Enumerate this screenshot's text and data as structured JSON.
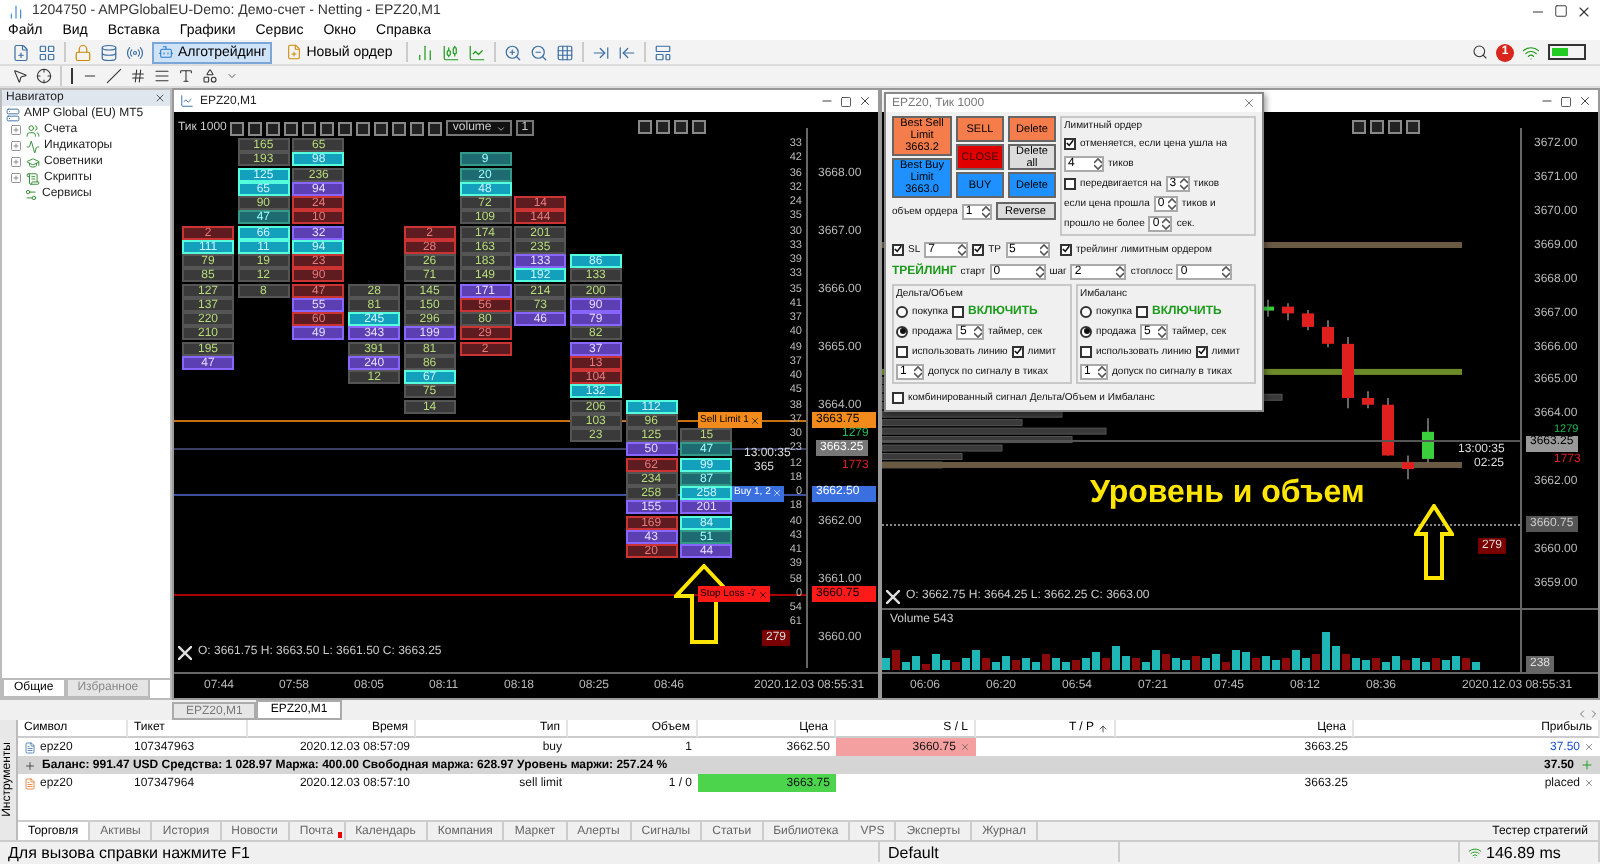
{
  "window": {
    "title": "1204750 - AMPGlobalEU-Demo: Демо-счет - Netting - EPZ20,M1",
    "notifications": "1"
  },
  "menu": [
    "Файл",
    "Вид",
    "Вставка",
    "Графики",
    "Сервис",
    "Окно",
    "Справка"
  ],
  "toolbar": {
    "algo": {
      "label": "Алготрейдинг",
      "on": true
    },
    "new_order": {
      "label": "Новый ордер"
    }
  },
  "navigator": {
    "title": "Навигатор",
    "root": "AMP Global (EU) MT5",
    "items": [
      {
        "label": "Счета",
        "kind": "accounts",
        "expandable": true
      },
      {
        "label": "Индикаторы",
        "kind": "indicators",
        "expandable": true
      },
      {
        "label": "Советники",
        "kind": "experts",
        "expandable": true
      },
      {
        "label": "Скрипты",
        "kind": "scripts",
        "expandable": true
      },
      {
        "label": "Сервисы",
        "kind": "services",
        "expandable": false
      }
    ],
    "tabs": [
      {
        "label": "Общие",
        "selected": true
      },
      {
        "label": "Избранное",
        "selected": false
      }
    ]
  },
  "chart1": {
    "title": "EPZ20,M1",
    "timeframe": "Тик  1000",
    "indicator": "volume",
    "multiplier": "1",
    "columns": [
      [
        {
          "v": "2",
          "kind": "red"
        },
        {
          "v": "111",
          "kind": "cyan"
        },
        {
          "v": "79",
          "kind": "plain"
        },
        {
          "v": "85",
          "kind": "plain"
        },
        {
          "v": "127",
          "kind": "plain"
        },
        {
          "v": "137",
          "kind": "plain"
        },
        {
          "v": "220",
          "kind": "plain"
        },
        {
          "v": "210",
          "kind": "plain"
        },
        {
          "v": "195",
          "kind": "plain"
        },
        {
          "v": "47",
          "kind": "purple"
        }
      ],
      [
        {
          "v": "165",
          "kind": "plain"
        },
        {
          "v": "193",
          "kind": "plain"
        },
        {
          "v": "125",
          "kind": "cyan"
        },
        {
          "v": "65",
          "kind": "cyan"
        },
        {
          "v": "90",
          "kind": "plain"
        },
        {
          "v": "47",
          "kind": "teal"
        },
        {
          "v": "66",
          "kind": "cyan"
        },
        {
          "v": "11",
          "kind": "cyan"
        },
        {
          "v": "19",
          "kind": "plain"
        },
        {
          "v": "12",
          "kind": "plain"
        },
        {
          "v": "8",
          "kind": "plain"
        }
      ],
      [
        {
          "v": "65",
          "kind": "plain"
        },
        {
          "v": "98",
          "kind": "cyan"
        },
        {
          "v": "236",
          "kind": "plain"
        },
        {
          "v": "94",
          "kind": "purple"
        },
        {
          "v": "24",
          "kind": "red"
        },
        {
          "v": "10",
          "kind": "red"
        },
        {
          "v": "32",
          "kind": "purple"
        },
        {
          "v": "94",
          "kind": "cyan"
        },
        {
          "v": "23",
          "kind": "red"
        },
        {
          "v": "90",
          "kind": "red"
        },
        {
          "v": "47",
          "kind": "red"
        },
        {
          "v": "55",
          "kind": "purple"
        },
        {
          "v": "60",
          "kind": "red"
        },
        {
          "v": "49",
          "kind": "purple"
        }
      ],
      [
        {
          "v": "28",
          "kind": "plain"
        },
        {
          "v": "81",
          "kind": "plain"
        },
        {
          "v": "245",
          "kind": "cyan"
        },
        {
          "v": "343",
          "kind": "purple"
        },
        {
          "v": "391",
          "kind": "plain"
        },
        {
          "v": "240",
          "kind": "purple"
        },
        {
          "v": "12",
          "kind": "plain"
        }
      ],
      [
        {
          "v": "2",
          "kind": "red"
        },
        {
          "v": "28",
          "kind": "red"
        },
        {
          "v": "26",
          "kind": "plain"
        },
        {
          "v": "71",
          "kind": "plain"
        },
        {
          "v": "145",
          "kind": "plain"
        },
        {
          "v": "150",
          "kind": "plain"
        },
        {
          "v": "296",
          "kind": "plain"
        },
        {
          "v": "199",
          "kind": "purple"
        },
        {
          "v": "81",
          "kind": "plain"
        },
        {
          "v": "86",
          "kind": "plain"
        },
        {
          "v": "67",
          "kind": "cyan"
        },
        {
          "v": "75",
          "kind": "plain"
        },
        {
          "v": "14",
          "kind": "plain"
        }
      ],
      [
        {
          "v": "9",
          "kind": "teal"
        },
        {
          "v": "20",
          "kind": "teal"
        },
        {
          "v": "48",
          "kind": "cyan"
        },
        {
          "v": "72",
          "kind": "plain"
        },
        {
          "v": "109",
          "kind": "plain"
        },
        {
          "v": "174",
          "kind": "plain"
        },
        {
          "v": "163",
          "kind": "plain"
        },
        {
          "v": "183",
          "kind": "plain"
        },
        {
          "v": "149",
          "kind": "plain"
        },
        {
          "v": "171",
          "kind": "purple"
        },
        {
          "v": "56",
          "kind": "red"
        },
        {
          "v": "80",
          "kind": "plain"
        },
        {
          "v": "29",
          "kind": "red"
        },
        {
          "v": "2",
          "kind": "red"
        }
      ],
      [
        {
          "v": "14",
          "kind": "red"
        },
        {
          "v": "144",
          "kind": "red"
        },
        {
          "v": "201",
          "kind": "plain"
        },
        {
          "v": "235",
          "kind": "plain"
        },
        {
          "v": "133",
          "kind": "purple"
        },
        {
          "v": "192",
          "kind": "cyan"
        },
        {
          "v": "214",
          "kind": "plain"
        },
        {
          "v": "73",
          "kind": "plain"
        },
        {
          "v": "46",
          "kind": "purple"
        }
      ],
      [
        {
          "v": "86",
          "kind": "cyan"
        },
        {
          "v": "133",
          "kind": "plain"
        },
        {
          "v": "200",
          "kind": "plain"
        },
        {
          "v": "90",
          "kind": "purple"
        },
        {
          "v": "79",
          "kind": "purple"
        },
        {
          "v": "82",
          "kind": "plain"
        },
        {
          "v": "37",
          "kind": "purple"
        },
        {
          "v": "13",
          "kind": "red"
        },
        {
          "v": "104",
          "kind": "red"
        },
        {
          "v": "132",
          "kind": "cyan"
        },
        {
          "v": "206",
          "kind": "plain"
        },
        {
          "v": "103",
          "kind": "plain"
        },
        {
          "v": "23",
          "kind": "plain"
        }
      ],
      [
        {
          "v": "112",
          "kind": "cyan"
        },
        {
          "v": "96",
          "kind": "plain"
        },
        {
          "v": "125",
          "kind": "plain"
        },
        {
          "v": "50",
          "kind": "purple"
        },
        {
          "v": "62",
          "kind": "red"
        },
        {
          "v": "234",
          "kind": "plain"
        },
        {
          "v": "258",
          "kind": "plain"
        },
        {
          "v": "155",
          "kind": "purple"
        },
        {
          "v": "169",
          "kind": "red"
        },
        {
          "v": "43",
          "kind": "purple"
        },
        {
          "v": "20",
          "kind": "red"
        }
      ],
      [
        {
          "v": "15",
          "kind": "plain"
        },
        {
          "v": "47",
          "kind": "teal"
        },
        {
          "v": "99",
          "kind": "cyan"
        },
        {
          "v": "87",
          "kind": "teal"
        },
        {
          "v": "258",
          "kind": "cyan"
        },
        {
          "v": "201",
          "kind": "purple"
        },
        {
          "v": "84",
          "kind": "cyan"
        },
        {
          "v": "51",
          "kind": "teal"
        },
        {
          "v": "44",
          "kind": "purple"
        }
      ]
    ],
    "depth": [
      "33",
      "42",
      "36",
      "32",
      "24",
      "35",
      "30",
      "33",
      "39",
      "33",
      "35",
      "41",
      "37",
      "40",
      "49",
      "37",
      "40",
      "45",
      "38",
      "37",
      "30",
      "23",
      "12",
      "18",
      "0",
      "18",
      "40",
      "43",
      "41",
      "39",
      "58",
      "0",
      "54",
      "61"
    ],
    "profile_max": "279",
    "prices": [
      "3668.00",
      "3667.00",
      "3666.00",
      "3665.00",
      "3664.00",
      "3662.00",
      "3661.00",
      "3660.00"
    ],
    "orders": [
      {
        "kind": "sell_limit",
        "label": "Sell Limit  1",
        "price": "3663.75"
      },
      {
        "kind": "buy",
        "label": "Buy  1,  2",
        "price": "3662.50"
      },
      {
        "kind": "stop_loss",
        "label": "Stop Loss  -7",
        "price": "3660.75"
      }
    ],
    "bid_volume": "1279",
    "last_price": "3663.25",
    "ask_volume": "1773",
    "timer": "13:00:35",
    "timer_sub": "365",
    "ohlc": "O: 3661.75   H: 3663.50   L: 3661.50   C: 3663.25",
    "times": [
      "07:44",
      "07:58",
      "08:05",
      "08:11",
      "08:18",
      "08:25",
      "08:46"
    ],
    "date": "2020.12.03 08:55:31"
  },
  "chart2": {
    "prices": [
      "3672.00",
      "3671.00",
      "3670.00",
      "3669.00",
      "3668.00",
      "3667.00",
      "3666.00",
      "3665.00",
      "3664.00",
      "3662.00",
      "3660.00",
      "3659.00"
    ],
    "bid_volume": "1279",
    "last_price": "3663.25",
    "ask_volume": "1773",
    "cursor_price": "3660.75",
    "profile_max": "279",
    "timer": "13:00:35",
    "timer_sub": "02:25",
    "caption": "Уровень и объем",
    "ohlc": "O: 3662.75   H: 3664.25   L: 3662.25   C: 3663.00",
    "volume_label": "Volume 543",
    "volume_axis": "238",
    "times": [
      "06:06",
      "06:20",
      "06:54",
      "07:21",
      "07:45",
      "08:12",
      "08:36"
    ],
    "date": "2020.12.03 08:55:31"
  },
  "panel": {
    "title": "EPZ20,  Тик  1000",
    "best": [
      {
        "label": "Best Sell Limit 3663.2",
        "kind": "sell"
      },
      {
        "label": "Best Buy Limit 3663.0",
        "kind": "buy"
      }
    ],
    "buttons": [
      {
        "label": "SELL",
        "kind": "sell"
      },
      {
        "label": "Delete",
        "kind": "sell"
      },
      {
        "label": "CLOSE",
        "kind": "close"
      },
      {
        "label": "Delete all",
        "kind": "neutral"
      },
      {
        "label": "BUY",
        "kind": "buy"
      },
      {
        "label": "Delete",
        "kind": "buy"
      }
    ],
    "volume": {
      "label": "объем ордера",
      "value": "1"
    },
    "reverse": "Reverse",
    "sl": {
      "label": "SL",
      "checked": true,
      "value": "7"
    },
    "tp": {
      "label": "TP",
      "checked": true,
      "value": "5"
    },
    "trailing": {
      "title": "ТРЕЙЛИНГ",
      "fields": [
        {
          "label": "старт",
          "value": "0"
        },
        {
          "label": "шаг",
          "value": "2"
        },
        {
          "label": "стоплосс",
          "value": "0"
        }
      ]
    },
    "limit_order": {
      "title": "Лимитный ордер",
      "cancel": {
        "label": "отменяется, если цена ушла на",
        "checked": true,
        "value": "4",
        "unit": "тиков"
      },
      "move": {
        "label": "передвигается на",
        "checked": false,
        "value": "3",
        "unit": "тиков"
      },
      "if_price": {
        "label": "если цена прошла",
        "value": "0",
        "unit": "тиков и"
      },
      "if_time": {
        "label": "прошло не более",
        "value": "0",
        "unit": "сек."
      },
      "trailing": {
        "label": "трейлинг лимитным ордером",
        "checked": true
      }
    },
    "groups": [
      {
        "title": "Дельта/Объем",
        "modes": [
          {
            "label": "покупка",
            "selected": false
          },
          {
            "label": "продажа",
            "selected": true
          }
        ],
        "enable": {
          "label": "ВКЛЮЧИТЬ",
          "checked": false
        },
        "timer": {
          "value": "5",
          "label": "таймер, сек"
        },
        "use_line": {
          "label": "использовать линию",
          "checked": false
        },
        "limit": {
          "label": "лимит",
          "checked": true
        },
        "tolerance": {
          "value": "1",
          "label": "допуск по сигналу в тиках"
        }
      },
      {
        "title": "Имбаланс",
        "modes": [
          {
            "label": "покупка",
            "selected": false
          },
          {
            "label": "продажа",
            "selected": true
          }
        ],
        "enable": {
          "label": "ВКЛЮЧИТЬ",
          "checked": false
        },
        "timer": {
          "value": "5",
          "label": "таймер, сек"
        },
        "use_line": {
          "label": "использовать линию",
          "checked": false
        },
        "limit": {
          "label": "лимит",
          "checked": true
        },
        "tolerance": {
          "value": "1",
          "label": "допуск по сигналу в тиках"
        }
      }
    ],
    "combined": {
      "label": "комбинированный сигнал Дельта/Объем и Имбаланс",
      "checked": false
    }
  },
  "chart_tabs": [
    {
      "label": "EPZ20,M1",
      "selected": false
    },
    {
      "label": "EPZ20,M1",
      "selected": true
    }
  ],
  "trade": {
    "side_label": "Инструменты",
    "columns": [
      "Символ",
      "Тикет",
      "Время",
      "Тип",
      "Объем",
      "Цена",
      "S / L",
      "T / P",
      "Цена",
      "Прибыль"
    ],
    "rows": [
      {
        "kind": "position",
        "symbol": "epz20",
        "ticket": "107347963",
        "time": "2020.12.03 08:57:09",
        "type": "buy",
        "volume": "1",
        "price": "3662.50",
        "sl": "3660.75",
        "current": "3663.25",
        "profit": "37.50"
      },
      {
        "kind": "balance",
        "text": "Баланс: 991.47 USD   Средства: 1 028.97   Маржа: 400.00   Свободная маржа: 628.97   Уровень маржи: 257.24 %",
        "profit": "37.50"
      },
      {
        "kind": "order",
        "symbol": "epz20",
        "ticket": "107347964",
        "time": "2020.12.03 08:57:10",
        "type": "sell limit",
        "volume": "1 / 0",
        "price": "3663.75",
        "current": "3663.25",
        "profit": "placed"
      }
    ],
    "tabs": [
      {
        "label": "Торговля",
        "selected": true,
        "new": false
      },
      {
        "label": "Активы",
        "selected": false,
        "new": false
      },
      {
        "label": "История",
        "selected": false,
        "new": false
      },
      {
        "label": "Новости",
        "selected": false,
        "new": false
      },
      {
        "label": "Почта",
        "selected": false,
        "new": true
      },
      {
        "label": "Календарь",
        "selected": false,
        "new": false
      },
      {
        "label": "Компания",
        "selected": false,
        "new": false
      },
      {
        "label": "Маркет",
        "selected": false,
        "new": false
      },
      {
        "label": "Алерты",
        "selected": false,
        "new": false
      },
      {
        "label": "Сигналы",
        "selected": false,
        "new": false
      },
      {
        "label": "Статьи",
        "selected": false,
        "new": false
      },
      {
        "label": "Библиотека",
        "selected": false,
        "new": false
      },
      {
        "label": "VPS",
        "selected": false,
        "new": false
      },
      {
        "label": "Эксперты",
        "selected": false,
        "new": false
      },
      {
        "label": "Журнал",
        "selected": false,
        "new": false
      }
    ],
    "tester": "Тестер стратегий"
  },
  "status": {
    "help": "Для вызова справки нажмите F1",
    "profile": "Default",
    "ping": "146.89 ms"
  }
}
